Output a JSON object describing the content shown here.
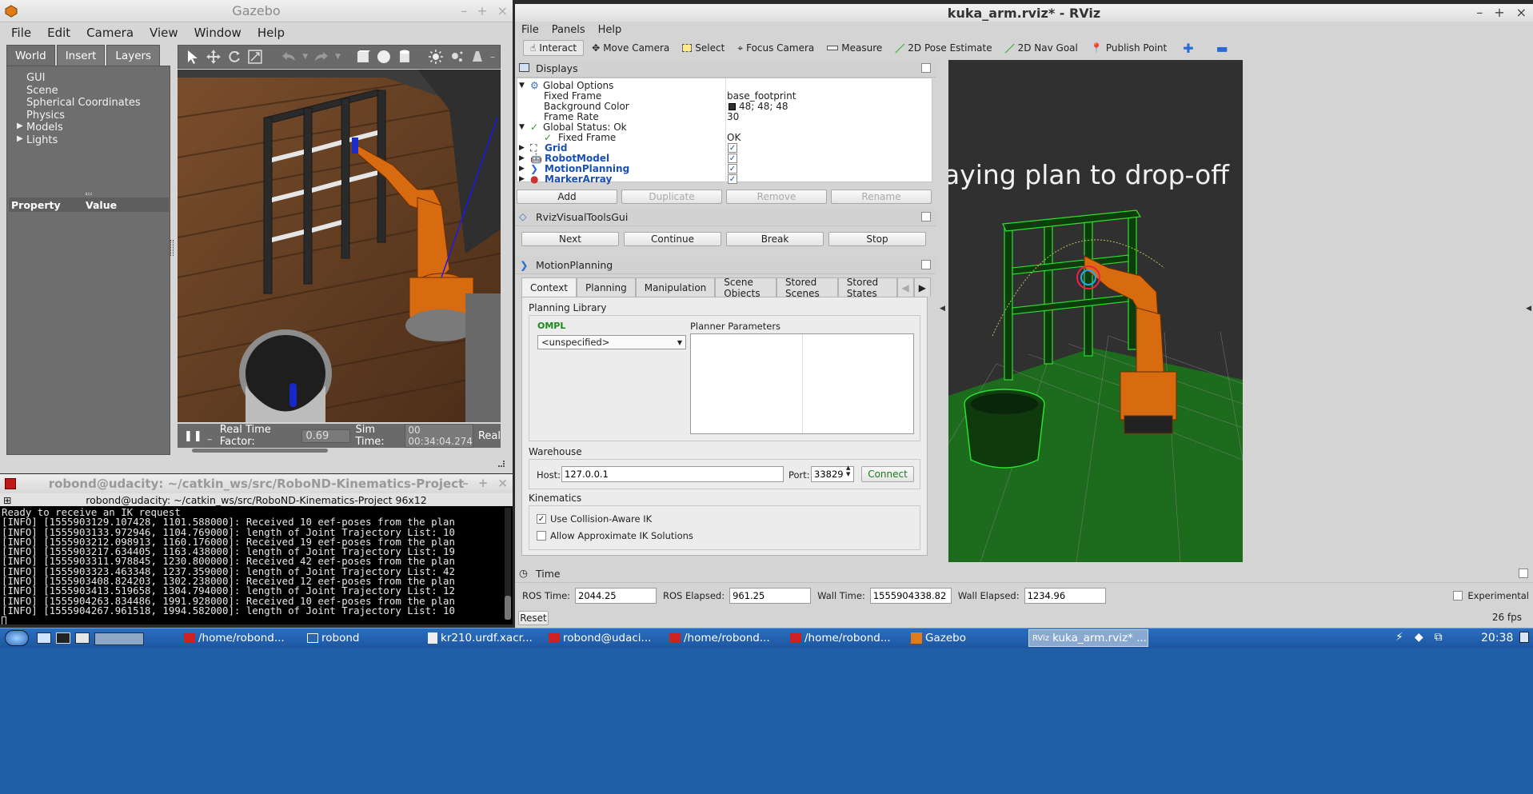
{
  "gazebo": {
    "title": "Gazebo",
    "menu": [
      "File",
      "Edit",
      "Camera",
      "View",
      "Window",
      "Help"
    ],
    "tabs": [
      "World",
      "Insert",
      "Layers"
    ],
    "tree": [
      "GUI",
      "Scene",
      "Spherical Coordinates",
      "Physics",
      "Models",
      "Lights"
    ],
    "prop_header": "Property",
    "value_header": "Value",
    "rtf_label": "Real Time Factor:",
    "rtf_value": "0.69",
    "sim_label": "Sim Time:",
    "sim_value": "00 00:34:04.274",
    "real_label": "Real"
  },
  "terminal": {
    "title": "robond@udacity: ~/catkin_ws/src/RoboND-Kinematics-Project",
    "subtitle": "robond@udacity: ~/catkin_ws/src/RoboND-Kinematics-Project 96x12",
    "lines": [
      "Ready to receive an IK request",
      "[INFO] [1555903129.107428, 1101.588000]: Received 10 eef-poses from the plan",
      "[INFO] [1555903133.972946, 1104.769000]: length of Joint Trajectory List: 10",
      "[INFO] [1555903212.098913, 1160.176000]: Received 19 eef-poses from the plan",
      "[INFO] [1555903217.634405, 1163.438000]: length of Joint Trajectory List: 19",
      "[INFO] [1555903311.978845, 1230.800000]: Received 42 eef-poses from the plan",
      "[INFO] [1555903323.463348, 1237.359000]: length of Joint Trajectory List: 42",
      "[INFO] [1555903408.824203, 1302.238000]: Received 12 eef-poses from the plan",
      "[INFO] [1555903413.519658, 1304.794000]: length of Joint Trajectory List: 12",
      "[INFO] [1555904263.834486, 1991.928000]: Received 10 eef-poses from the plan",
      "[INFO] [1555904267.961518, 1994.582000]: length of Joint Trajectory List: 10"
    ]
  },
  "rviz": {
    "title": "kuka_arm.rviz* - RViz",
    "menu": [
      "File",
      "Panels",
      "Help"
    ],
    "toolbar": [
      "Interact",
      "Move Camera",
      "Select",
      "Focus Camera",
      "Measure",
      "2D Pose Estimate",
      "2D Nav Goal",
      "Publish Point"
    ],
    "displays_title": "Displays",
    "global_options": "Global Options",
    "fixed_frame_label": "Fixed Frame",
    "fixed_frame_value": "base_footprint",
    "bg_color_label": "Background Color",
    "bg_color_value": "48; 48; 48",
    "frame_rate_label": "Frame Rate",
    "frame_rate_value": "30",
    "global_status": "Global Status: Ok",
    "fixed_frame_status_label": "Fixed Frame",
    "fixed_frame_status_value": "OK",
    "displays": [
      "Grid",
      "RobotModel",
      "MotionPlanning",
      "MarkerArray"
    ],
    "buttons": [
      "Add",
      "Duplicate",
      "Remove",
      "Rename"
    ],
    "visual_tools_title": "RvizVisualToolsGui",
    "visual_tools_buttons": [
      "Next",
      "Continue",
      "Break",
      "Stop"
    ],
    "motion_planning_title": "MotionPlanning",
    "mp_tabs": [
      "Context",
      "Planning",
      "Manipulation",
      "Scene Objects",
      "Stored Scenes",
      "Stored States"
    ],
    "planning_library": "Planning Library",
    "ompl": "OMPL",
    "planner_select": "<unspecified>",
    "planner_params": "Planner Parameters",
    "warehouse": "Warehouse",
    "host_label": "Host:",
    "host_value": "127.0.0.1",
    "port_label": "Port:",
    "port_value": "33829",
    "connect": "Connect",
    "kinematics": "Kinematics",
    "collision_ik": "Use Collision-Aware IK",
    "approx_ik": "Allow Approximate IK Solutions",
    "viewport_text": "aying  plan  to  drop-off",
    "time_title": "Time",
    "ros_time_label": "ROS Time:",
    "ros_time": "2044.25",
    "ros_elapsed_label": "ROS Elapsed:",
    "ros_elapsed": "961.25",
    "wall_time_label": "Wall Time:",
    "wall_time": "1555904338.82",
    "wall_elapsed_label": "Wall Elapsed:",
    "wall_elapsed": "1234.96",
    "experimental": "Experimental",
    "reset": "Reset",
    "fps": "26 fps"
  },
  "taskbar": {
    "tasks": [
      "/home/robond...",
      "robond",
      "kr210.urdf.xacr...",
      "robond@udaci...",
      "/home/robond...",
      "/home/robond...",
      "Gazebo",
      "kuka_arm.rviz* ..."
    ],
    "clock": "20:38"
  }
}
